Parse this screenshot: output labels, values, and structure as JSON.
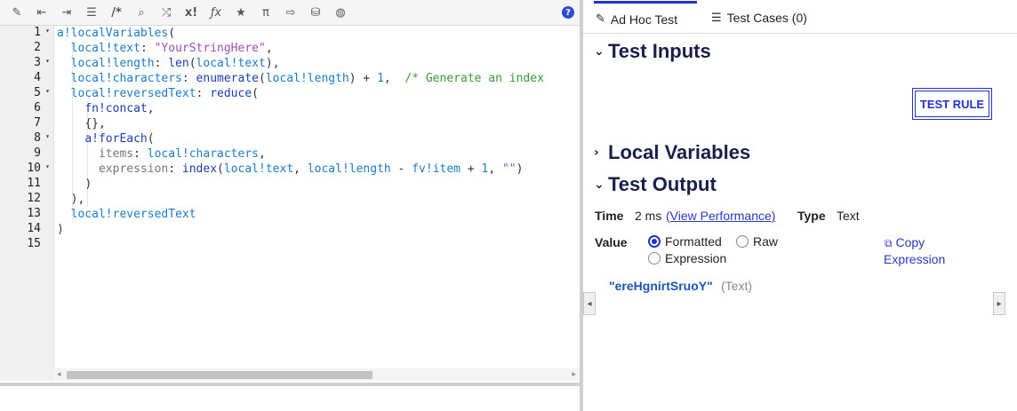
{
  "toolbar": {
    "icons": [
      "magic-wand-icon",
      "outdent-icon",
      "indent-icon",
      "list-icon",
      "comment-icon",
      "search-icon",
      "shuffle-icon",
      "factorial-icon",
      "function-icon",
      "star-icon",
      "pi-icon",
      "export-icon",
      "database-search-icon",
      "globe-icon"
    ],
    "help": "?"
  },
  "editor": {
    "line_numbers": [
      "1",
      "2",
      "3",
      "4",
      "5",
      "6",
      "7",
      "8",
      "9",
      "10",
      "11",
      "12",
      "13",
      "14",
      "15"
    ],
    "folds": [
      "▾",
      "",
      "▾",
      "",
      "▾",
      "",
      "",
      "▾",
      "",
      "▾",
      "",
      "",
      "",
      "",
      ""
    ],
    "line1": {
      "a": "a!localVariables",
      "b": "("
    },
    "line2": {
      "a": "local!text",
      "b": ": ",
      "c": "\"YourStringHere\"",
      "d": ","
    },
    "line3": {
      "a": "local!length",
      "b": ": ",
      "c": "len",
      "d": "(",
      "e": "local!text",
      "f": "),"
    },
    "line4": {
      "a": "local!characters",
      "b": ": ",
      "c": "enumerate",
      "d": "(",
      "e": "local!length",
      "f": ") + ",
      "g": "1",
      "h": ",  ",
      "i": "/* Generate an index"
    },
    "line5": {
      "a": "local!reversedText",
      "b": ": ",
      "c": "reduce",
      "d": "("
    },
    "line6": {
      "a": "fn!concat",
      "b": ","
    },
    "line7": {
      "a": "{},"
    },
    "line8": {
      "a": "a!forEach",
      "b": "("
    },
    "line9": {
      "a": "items",
      "b": ": ",
      "c": "local!characters",
      "d": ","
    },
    "line10": {
      "a": "expression",
      "b": ": ",
      "c": "index",
      "d": "(",
      "e": "local!text",
      "f": ", ",
      "g": "local!length",
      "h": " - ",
      "i": "fv!item",
      "j": " + ",
      "k": "1",
      "l": ", ",
      "m": "\"\"",
      "n": ")"
    },
    "line11": {
      "a": ")"
    },
    "line12": {
      "a": "),"
    },
    "line13": {
      "a": "local!reversedText"
    },
    "line14": {
      "a": ")"
    }
  },
  "tabs": [
    {
      "label": "Ad Hoc Test",
      "icon": "edit-icon",
      "active": true
    },
    {
      "label": "Test Cases (0)",
      "icon": "list-icon",
      "active": false
    }
  ],
  "sections": {
    "inputs": "Test Inputs",
    "locals": "Local Variables",
    "output": "Test Output"
  },
  "test_rule_label": "TEST RULE",
  "output": {
    "time_label": "Time",
    "time_value": "2 ms",
    "perf_link": "(View Performance)",
    "type_label": "Type",
    "type_value": "Text",
    "value_label": "Value",
    "radio_formatted": "Formatted",
    "radio_raw": "Raw",
    "radio_expression": "Expression",
    "copy_label_1": "Copy",
    "copy_label_2": "Expression",
    "result_value": "\"ereHgnirtSruoY\"",
    "result_type": "(Text)"
  }
}
